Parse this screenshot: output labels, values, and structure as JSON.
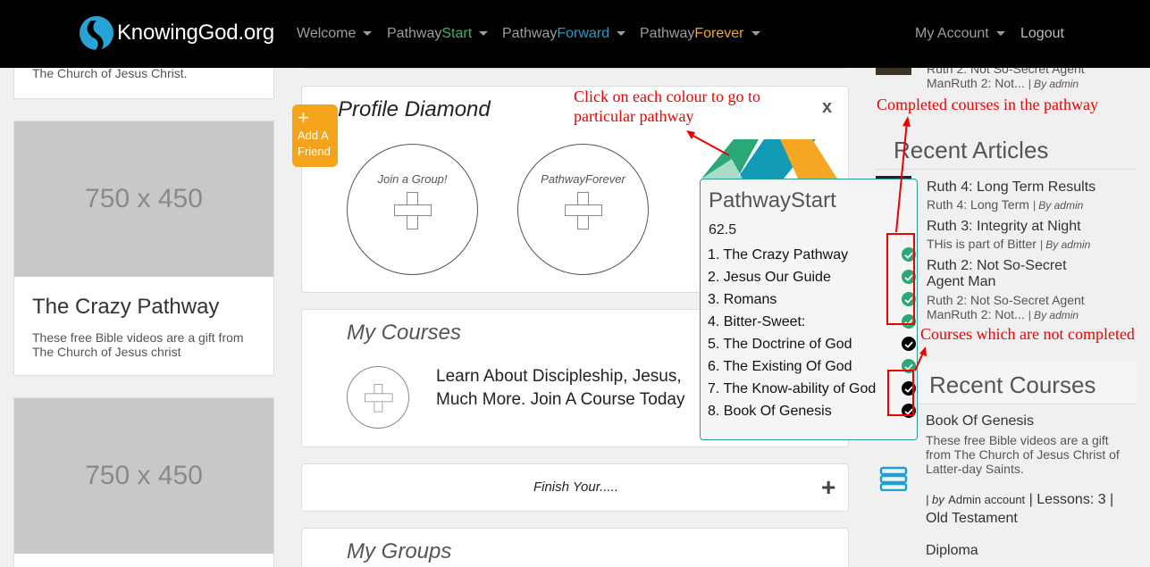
{
  "nav": {
    "brand": "KnowingGod.org",
    "items": [
      {
        "label": "Welcome",
        "pre": "",
        "accent": ""
      },
      {
        "label": "Pathway",
        "accent": "Start",
        "color": "#3cb371"
      },
      {
        "label": "Pathway",
        "accent": "Forward",
        "color": "#1e9ec8"
      },
      {
        "label": "Pathway",
        "accent": "Forever",
        "color": "#f5a623"
      }
    ],
    "account": "My Account",
    "logout": "Logout"
  },
  "left": {
    "top_text": "The Church of Jesus Christ.",
    "card1": {
      "placeholder": "750 x 450",
      "title": "The Crazy Pathway",
      "desc": "These free Bible videos are a gift from The Church of Jesus christ"
    },
    "card2": {
      "placeholder": "750 x 450"
    }
  },
  "profile": {
    "add_friend_plus": "+",
    "add_friend": "Add A Friend",
    "title": "Profile Diamond",
    "close": "x",
    "join_group": "Join a Group!",
    "pathway_forever": "PathwayForever"
  },
  "courses": {
    "title": "My Courses",
    "text": "Learn About Discipleship, Jesus, Much More. Join A Course Today"
  },
  "finish": {
    "text": "Finish Your....."
  },
  "groups": {
    "title": "My Groups"
  },
  "popup": {
    "title": "PathwayStart",
    "score": "62.5",
    "items": [
      {
        "label": "1. The Crazy Pathway",
        "done": true
      },
      {
        "label": "2. Jesus Our Guide",
        "done": true
      },
      {
        "label": "3. Romans",
        "done": true
      },
      {
        "label": "4. Bitter-Sweet:",
        "done": true
      },
      {
        "label": "5. The Doctrine of God",
        "done": false
      },
      {
        "label": "6. The Existing Of God",
        "done": true
      },
      {
        "label": "7. The Know-ability of God",
        "done": false
      },
      {
        "label": "8. Book Of Genesis",
        "done": false
      }
    ],
    "colors": {
      "done": "#2aa876",
      "not_done": "#000000"
    }
  },
  "right": {
    "top_article": {
      "title": "Ruth 2: Not So-Secret Agent",
      "sub": "ManRuth 2: Not...",
      "by": "| By admin"
    },
    "recent_articles_title": "Recent Articles",
    "articles": [
      {
        "title": "Ruth 4: Long Term Results",
        "sub": "Ruth 4: Long Term",
        "by": "| By admin"
      },
      {
        "title": "Ruth 3: Integrity at Night",
        "sub": "THis is part of Bitter",
        "by": "| By admin"
      },
      {
        "title": "Ruth 2: Not So-Secret Agent Man",
        "sub": "Ruth 2: Not So-Secret Agent ManRuth 2: Not...",
        "by": "| By admin"
      }
    ],
    "recent_courses_title": "Recent Courses",
    "course": {
      "title": "Book Of Genesis",
      "desc": "These free Bible videos are a gift from The Church of Jesus Christ of Latter-day Saints.",
      "by_prefix": "| by",
      "author": "Admin account",
      "lessons": "| Lessons: 3 |",
      "category": "Old Testament"
    },
    "next": "Diploma"
  },
  "annotations": {
    "colour_hint": "Click on each colour to go to particular pathway",
    "completed": "Completed courses in the pathway",
    "not_completed": "Courses which are not completed"
  }
}
